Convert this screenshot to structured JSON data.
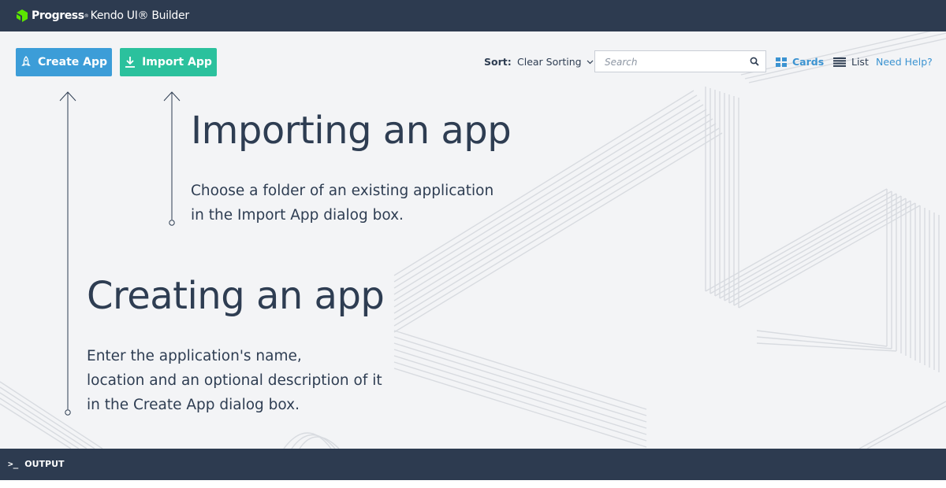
{
  "app": {
    "brand": "Progress",
    "brand_mark": "®",
    "product": "Kendo UI® Builder"
  },
  "toolbar": {
    "create_label": "Create App",
    "import_label": "Import App",
    "sort_label": "Sort:",
    "sort_value": "Clear Sorting",
    "search_placeholder": "Search",
    "cards_label": "Cards",
    "list_label": "List",
    "help_label": "Need Help?"
  },
  "tutorial": {
    "import_title": "Importing an app",
    "import_line1": "Choose a folder of an existing application",
    "import_line2": "in the Import App dialog box.",
    "create_title": "Creating an app",
    "create_line1": "Enter the application's name,",
    "create_line2": "location and an optional description of it",
    "create_line3": "in the Create App dialog box."
  },
  "footer": {
    "prompt": ">_",
    "output_label": "OUTPUT"
  },
  "colors": {
    "header_bg": "#2d3b50",
    "create_button": "#3c9dd8",
    "import_button": "#2bc19d",
    "link": "#3b93d1",
    "canvas_bg": "#f3f4f6"
  }
}
